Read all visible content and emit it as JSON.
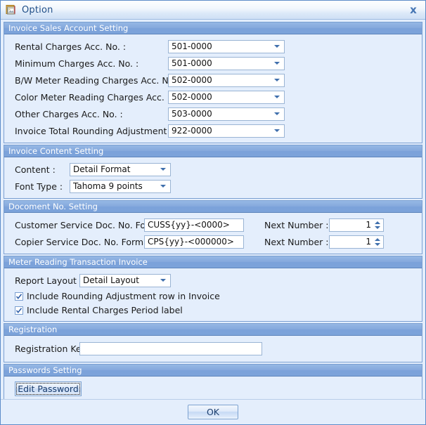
{
  "window": {
    "title": "Option",
    "icon": "option-document-icon",
    "close_label": "x"
  },
  "sections": {
    "invoice_sales_account": {
      "header": "Invoice Sales Account Setting",
      "fields": [
        {
          "label": "Rental Charges Acc. No. :",
          "value": "501-0000"
        },
        {
          "label": "Minimum Charges Acc. No. :",
          "value": "501-0000"
        },
        {
          "label": "B/W Meter Reading Charges Acc. No. :",
          "value": "502-0000"
        },
        {
          "label": "Color Meter Reading Charges Acc. No. :",
          "value": "502-0000"
        },
        {
          "label": "Other Charges Acc. No. :",
          "value": "503-0000"
        },
        {
          "label": "Invoice Total Rounding Adjustment Acc. No.",
          "value": "922-0000"
        }
      ]
    },
    "invoice_content": {
      "header": "Invoice Content Setting",
      "fields": [
        {
          "label": "Content :",
          "value": "Detail Format"
        },
        {
          "label": "Font Type :",
          "value": "Tahoma 9 points"
        }
      ]
    },
    "document_no": {
      "header": "Docoment No. Setting",
      "rows": [
        {
          "label": "Customer Service Doc. No. Format :",
          "value": "CUSS{yy}-<0000>",
          "next_label": "Next Number :",
          "next_value": "1"
        },
        {
          "label": "Copier Service Doc. No. Format :",
          "value": "CPS{yy}-<000000>",
          "next_label": "Next Number :",
          "next_value": "1"
        }
      ]
    },
    "meter_reading": {
      "header": "Meter Reading Transaction Invoice",
      "report_layout_label": "Report Layout :",
      "report_layout_value": "Detail Layout",
      "checkboxes": [
        {
          "label": "Include Rounding Adjustment row in Invoice",
          "checked": true
        },
        {
          "label": "Include Rental Charges Period label",
          "checked": true
        }
      ]
    },
    "registration": {
      "header": "Registration",
      "key_label": "Registration Key :",
      "key_value": ""
    },
    "passwords": {
      "header": "Passwords Setting",
      "edit_button": "Edit Password"
    }
  },
  "footer": {
    "ok_label": "OK"
  },
  "colors": {
    "window_bg": "#e4eefc",
    "group_header_blue": "#85a9dd",
    "title_text": "#1f4e88",
    "border": "#7a9fd1"
  }
}
